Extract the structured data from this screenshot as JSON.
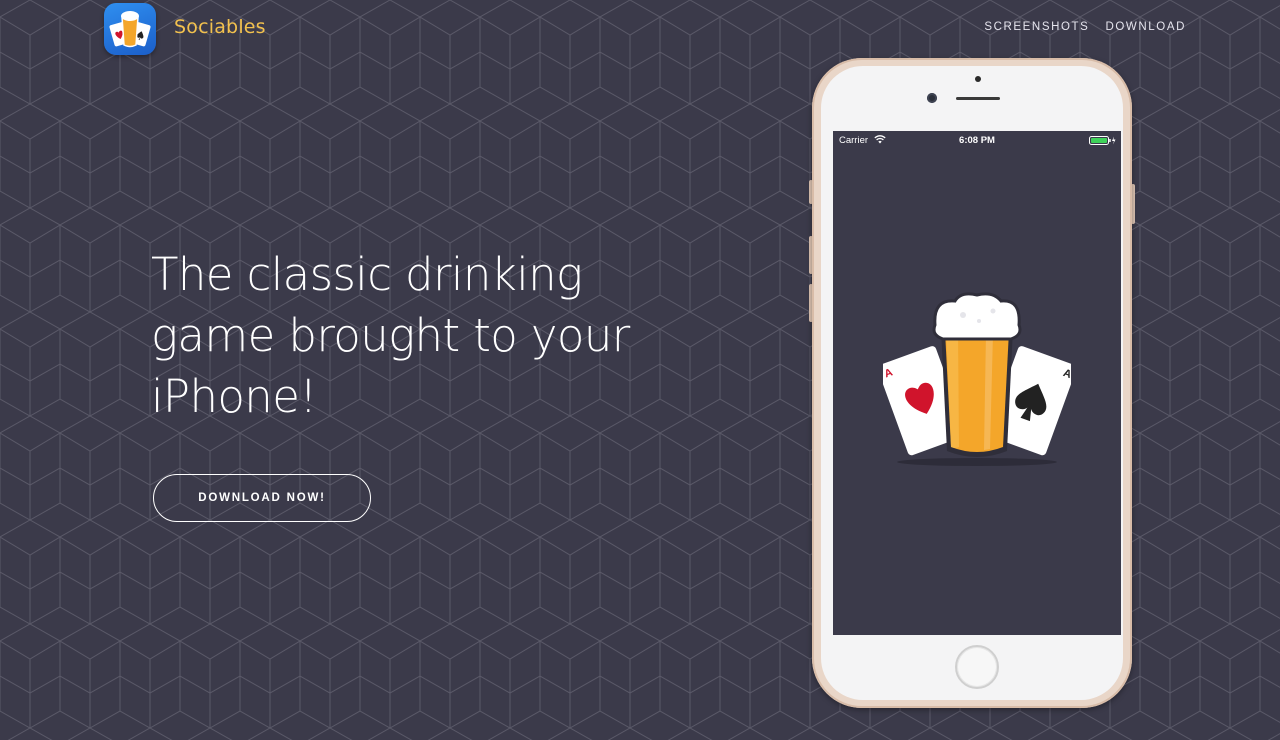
{
  "brand": {
    "name": "Sociables",
    "logo_icon": "beer-cards-logo-icon",
    "name_color": "#f2c14e"
  },
  "nav": {
    "items": [
      {
        "label": "SCREENSHOTS"
      },
      {
        "label": "DOWNLOAD"
      }
    ]
  },
  "hero": {
    "headline": "The classic drinking game brought to your iPhone!",
    "cta_label": "DOWNLOAD NOW!"
  },
  "phone": {
    "status": {
      "carrier": "Carrier",
      "time": "6:08 PM"
    },
    "splash_icon": "beer-and-playing-cards-icon"
  },
  "colors": {
    "background": "#3b3a4a",
    "accent": "#f2c14e",
    "text": "#ffffff",
    "beer": "#f4a62a",
    "heart": "#d0142c"
  }
}
